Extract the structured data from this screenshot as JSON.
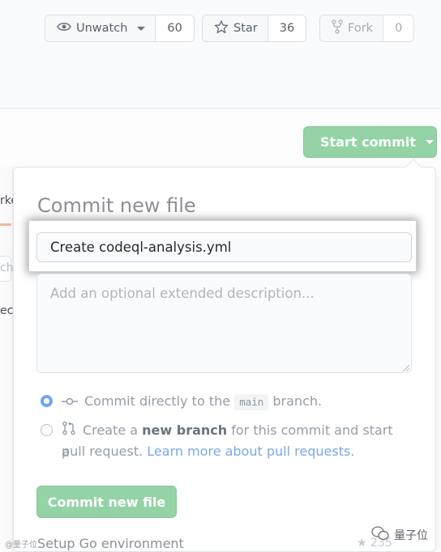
{
  "header": {
    "watch": {
      "label": "Unwatch",
      "count": "60"
    },
    "star": {
      "label": "Star",
      "count": "36"
    },
    "fork": {
      "label": "Fork",
      "count": "0"
    }
  },
  "background": {
    "tab_fragment": "rke",
    "search_fragment": "ch",
    "row_fragment": "ec",
    "footer_row": "Setup Go environment",
    "footer_count": "★ 235"
  },
  "start_commit": {
    "label": "Start commit"
  },
  "popover": {
    "title": "Commit new file",
    "title_value": "Create codeql-analysis.yml",
    "description_placeholder": "Add an optional extended description...",
    "option_direct": {
      "prefix": "Commit directly to the",
      "branch": "main",
      "suffix": "branch."
    },
    "option_new_branch": {
      "prefix": "Create a",
      "bold": "new branch",
      "middle": "for this commit and start a",
      "line2": "pull request.",
      "link": "Learn more about pull requests."
    },
    "commit_button": "Commit new file"
  },
  "watermark": {
    "left": "@量子位",
    "right": "量子位"
  },
  "colors": {
    "primary_green": "#94d3a6",
    "radio_blue": "#71a5f3",
    "link_blue": "#7aa9e6"
  }
}
